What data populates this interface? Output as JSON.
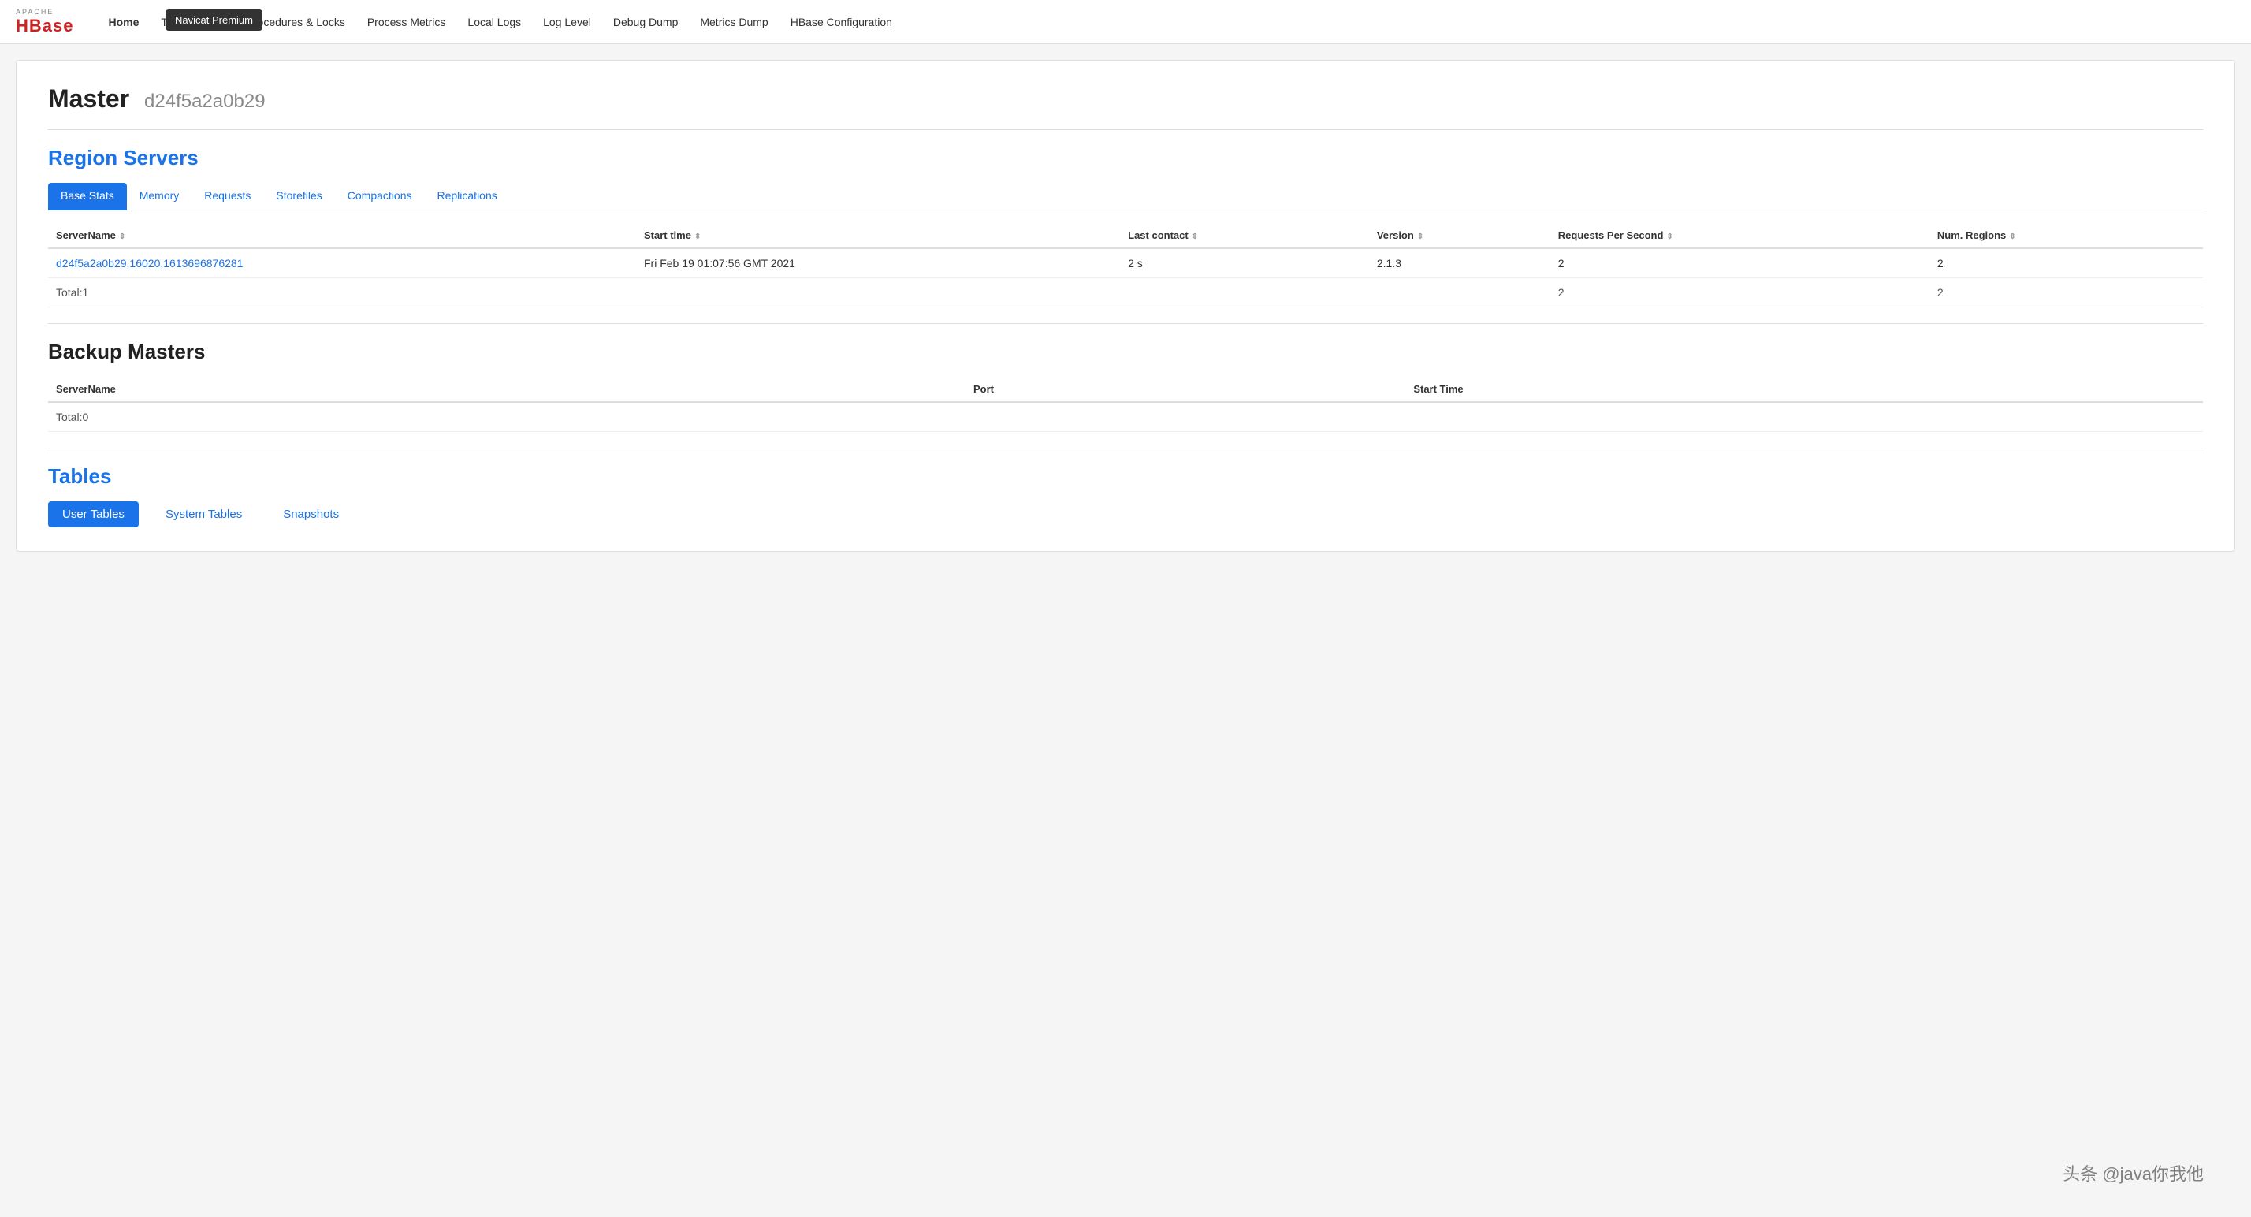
{
  "nav": {
    "logo_apache": "APACHE",
    "logo_hbase": "HBase",
    "links": [
      {
        "label": "Home",
        "active": true
      },
      {
        "label": "Table Details",
        "active": false
      },
      {
        "label": "Procedures & Locks",
        "active": false
      },
      {
        "label": "Process Metrics",
        "active": false
      },
      {
        "label": "Local Logs",
        "active": false
      },
      {
        "label": "Log Level",
        "active": false
      },
      {
        "label": "Debug Dump",
        "active": false
      },
      {
        "label": "Metrics Dump",
        "active": false
      },
      {
        "label": "HBase Configuration",
        "active": false
      }
    ]
  },
  "tooltip": "Navicat Premium",
  "master": {
    "title": "Master",
    "id": "d24f5a2a0b29"
  },
  "region_servers": {
    "section_title": "Region Servers",
    "tabs": [
      {
        "label": "Base Stats",
        "active": true
      },
      {
        "label": "Memory",
        "active": false
      },
      {
        "label": "Requests",
        "active": false
      },
      {
        "label": "Storefiles",
        "active": false
      },
      {
        "label": "Compactions",
        "active": false
      },
      {
        "label": "Replications",
        "active": false
      }
    ],
    "table": {
      "columns": [
        {
          "label": "ServerName",
          "sortable": true
        },
        {
          "label": "Start time",
          "sortable": true
        },
        {
          "label": "Last contact",
          "sortable": true
        },
        {
          "label": "Version",
          "sortable": true
        },
        {
          "label": "Requests Per Second",
          "sortable": true
        },
        {
          "label": "Num. Regions",
          "sortable": true
        }
      ],
      "rows": [
        {
          "server_name": "d24f5a2a0b29,16020,1613696876281",
          "start_time": "Fri Feb 19 01:07:56 GMT 2021",
          "last_contact": "2 s",
          "version": "2.1.3",
          "requests_per_second": "2",
          "num_regions": "2"
        }
      ],
      "total_row": {
        "label": "Total:1",
        "requests_per_second": "2",
        "num_regions": "2"
      }
    }
  },
  "backup_masters": {
    "section_title": "Backup Masters",
    "table": {
      "columns": [
        {
          "label": "ServerName"
        },
        {
          "label": "Port"
        },
        {
          "label": "Start Time"
        }
      ],
      "total_row": {
        "label": "Total:0"
      }
    }
  },
  "tables": {
    "section_title": "Tables",
    "tabs": [
      {
        "label": "User Tables",
        "active": true
      },
      {
        "label": "System Tables",
        "active": false
      },
      {
        "label": "Snapshots",
        "active": false
      }
    ]
  },
  "watermark": "头条 @java你我他"
}
